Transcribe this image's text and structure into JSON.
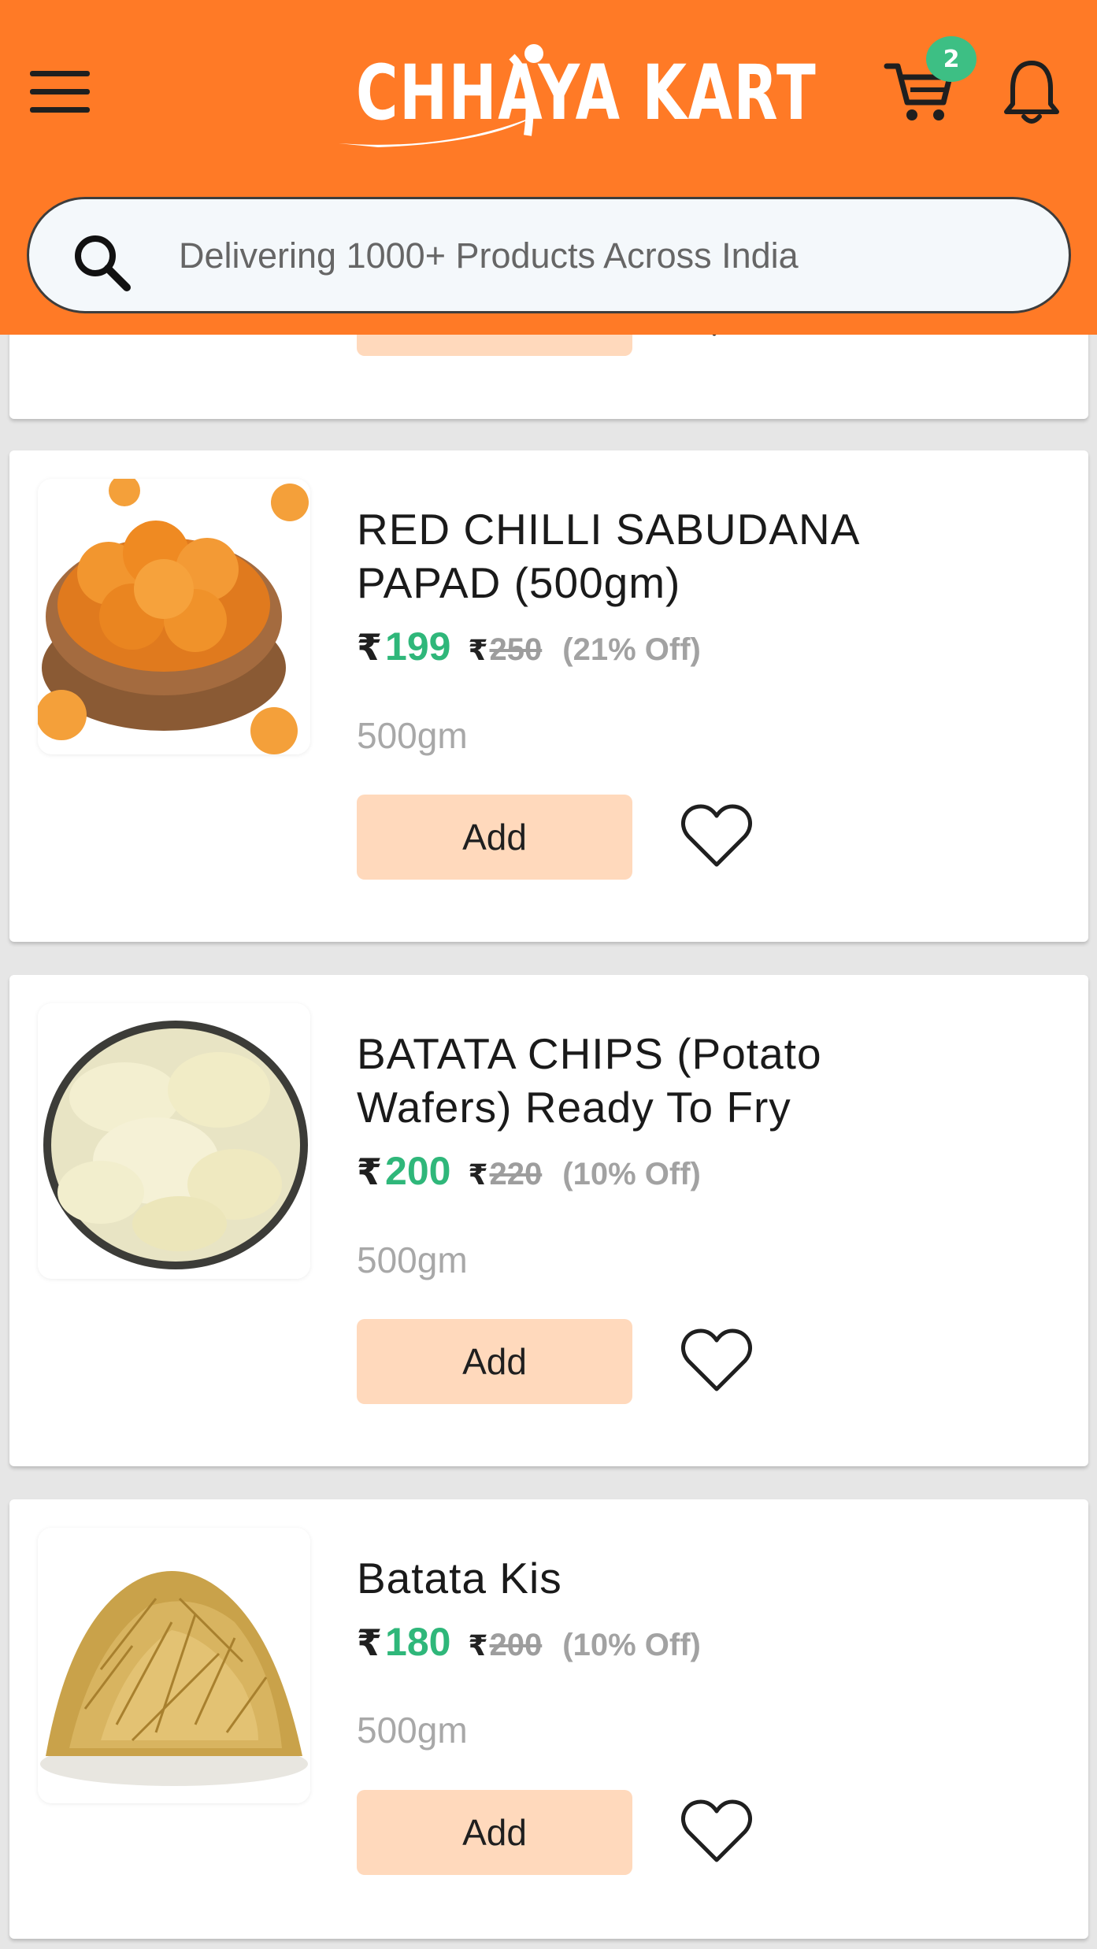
{
  "header": {
    "logo_text": "CHHAYA KART",
    "cart_count": "2",
    "brand_color": "#ff7a26",
    "badge_color": "#3dbf84",
    "icons": [
      "menu-icon",
      "cart-icon",
      "bell-icon"
    ]
  },
  "search": {
    "placeholder": "Delivering 1000+ Products Across India",
    "icon": "search-icon"
  },
  "products": [
    {
      "title": "RED CHILLI SABUDANA PAPAD (500gm)",
      "currency": "₹",
      "price": "199",
      "mrp": "250",
      "discount": "(21% Off)",
      "weight": "500gm",
      "add_label": "Add"
    },
    {
      "title": "BATATA CHIPS (Potato Wafers) Ready To Fry",
      "currency": "₹",
      "price": "200",
      "mrp": "220",
      "discount": "(10% Off)",
      "weight": "500gm",
      "add_label": "Add"
    },
    {
      "title": "Batata Kis",
      "currency": "₹",
      "price": "180",
      "mrp": "200",
      "discount": "(10% Off)",
      "weight": "500gm",
      "add_label": "Add"
    }
  ],
  "colors": {
    "price_green": "#2fb77a",
    "add_button_bg": "#ffd9bc"
  }
}
